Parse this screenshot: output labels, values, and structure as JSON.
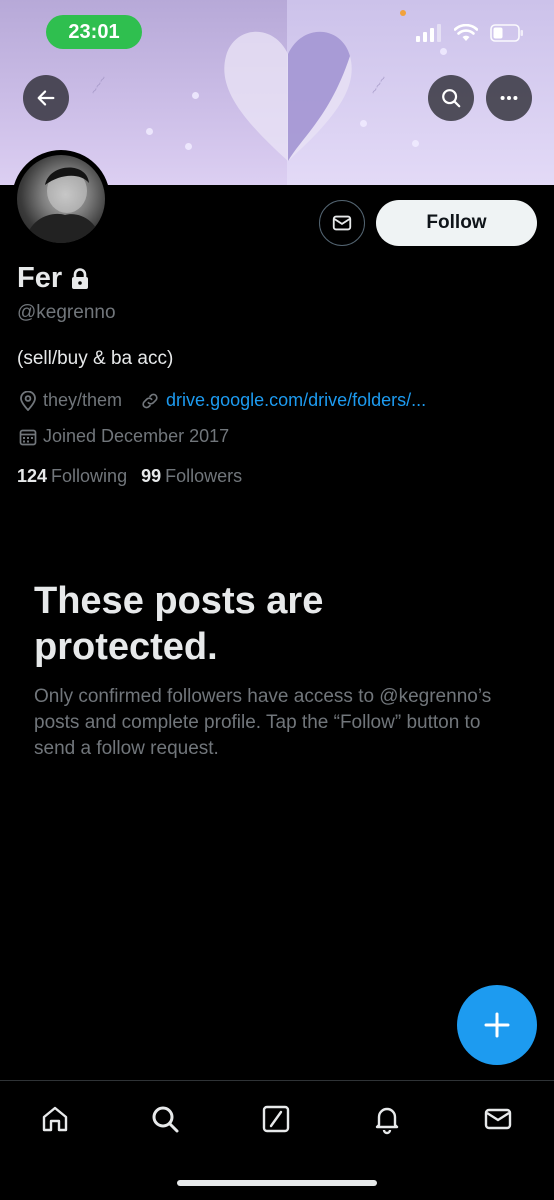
{
  "status_bar": {
    "time": "23:01"
  },
  "banner": {
    "accent": "#b7a9d8"
  },
  "profile": {
    "display_name": "Fer",
    "handle": "@kegrenno",
    "bio": "(sell/buy & ba acc)",
    "pronouns": "they/them",
    "link": "drive.google.com/drive/folders/...",
    "joined": "Joined December 2017",
    "following_count": "124",
    "following_label": "Following",
    "followers_count": "99",
    "followers_label": "Followers"
  },
  "actions": {
    "follow_label": "Follow"
  },
  "protected": {
    "title": "These posts are protected.",
    "body": "Only confirmed followers have access to @kegrenno’s posts and complete profile. Tap the “Follow” button to send a follow request."
  },
  "icons": {
    "back": "arrow-left-icon",
    "search": "search-icon",
    "more": "more-icon",
    "mail": "mail-icon",
    "lock": "lock-icon",
    "location": "location-pin-icon",
    "link": "link-icon",
    "calendar": "calendar-icon",
    "compose": "plus-icon",
    "home": "home-icon",
    "explore": "search-icon",
    "grok": "grok-icon",
    "notifications": "bell-icon",
    "messages": "mail-icon"
  },
  "colors": {
    "accent_blue": "#1d9bf0",
    "background": "#000000",
    "muted_text": "#71767b"
  }
}
